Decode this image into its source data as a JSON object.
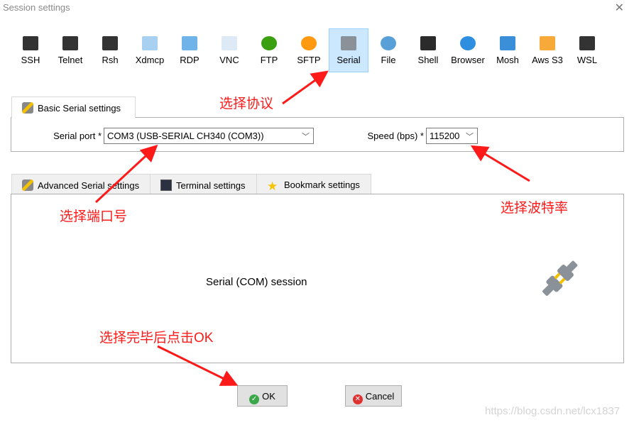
{
  "window": {
    "title": "Session settings",
    "close_icon": "close-icon"
  },
  "session_types": [
    {
      "label": "SSH",
      "icon": "key-icon",
      "color": "#333333"
    },
    {
      "label": "Telnet",
      "icon": "purple-gem-icon",
      "color": "#333333"
    },
    {
      "label": "Rsh",
      "icon": "gears-icon",
      "color": "#333333"
    },
    {
      "label": "Xdmcp",
      "icon": "x-monitor-icon",
      "color": "#a8d0f0"
    },
    {
      "label": "RDP",
      "icon": "windows-monitor-icon",
      "color": "#6fb3e8"
    },
    {
      "label": "VNC",
      "icon": "vnc-monitor-icon",
      "color": "#dde9f5"
    },
    {
      "label": "FTP",
      "icon": "green-globe-icon",
      "color": "#3aa010"
    },
    {
      "label": "SFTP",
      "icon": "orange-globe-icon",
      "color": "#ff9a10"
    },
    {
      "label": "Serial",
      "icon": "plug-icon",
      "color": "#8a9198",
      "selected": true
    },
    {
      "label": "File",
      "icon": "globe-monitor-icon",
      "color": "#5aa0d8"
    },
    {
      "label": "Shell",
      "icon": "terminal-icon",
      "color": "#2b2b2b"
    },
    {
      "label": "Browser",
      "icon": "globe-icon",
      "color": "#2e8fe0"
    },
    {
      "label": "Mosh",
      "icon": "satellite-dish-icon",
      "color": "#3a8fd8"
    },
    {
      "label": "Aws S3",
      "icon": "cubes-icon",
      "color": "#f7a93a"
    },
    {
      "label": "WSL",
      "icon": "windows-icon",
      "color": "#333333"
    }
  ],
  "basic_tab": {
    "label": "Basic Serial settings"
  },
  "basic": {
    "serial_port_label": "Serial port *",
    "serial_port_value": "COM3  (USB-SERIAL CH340 (COM3))",
    "speed_label": "Speed (bps) *",
    "speed_value": "115200"
  },
  "lower_tabs": [
    {
      "label": "Advanced Serial settings",
      "icon": "plug-icon"
    },
    {
      "label": "Terminal settings",
      "icon": "terminal-gear-icon"
    },
    {
      "label": "Bookmark settings",
      "icon": "star-icon"
    }
  ],
  "content": {
    "description": "Serial (COM) session"
  },
  "buttons": {
    "ok": "OK",
    "cancel": "Cancel"
  },
  "annotations": {
    "protocol": "选择协议",
    "port": "选择端口号",
    "baud": "选择波特率",
    "ok": "选择完毕后点击OK"
  },
  "watermark": "https://blog.csdn.net/lcx1837",
  "colors": {
    "annotation": "#ff1a1a",
    "selected_bg": "#cce8ff"
  }
}
